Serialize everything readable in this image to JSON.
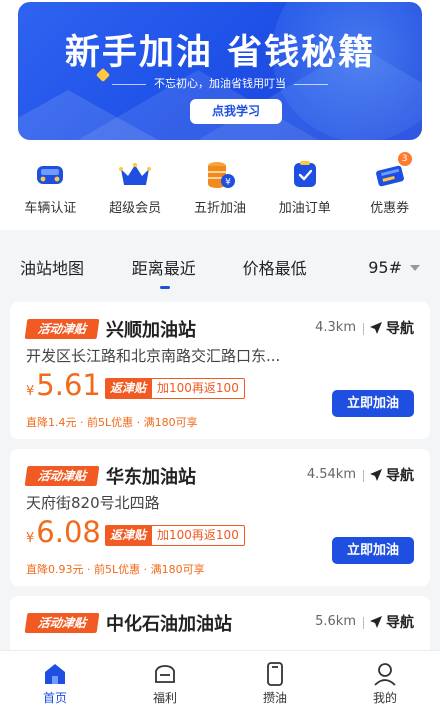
{
  "banner": {
    "title": "新手加油 省钱秘籍",
    "subtitle": "不忘初心，加油省钱用叮当",
    "button": "点我学习"
  },
  "quick_nav": [
    {
      "label": "车辆认证",
      "icon": "car-icon"
    },
    {
      "label": "超级会员",
      "icon": "crown-icon"
    },
    {
      "label": "五折加油",
      "icon": "coin-stack-icon"
    },
    {
      "label": "加油订单",
      "icon": "order-icon"
    },
    {
      "label": "优惠券",
      "icon": "coupon-icon",
      "badge": "3"
    }
  ],
  "filter": {
    "map": "油站地图",
    "nearest": "距离最近",
    "cheapest": "价格最低",
    "fuel": "95#"
  },
  "stations": [
    {
      "tag": "活动津贴",
      "name": "兴顺加油站",
      "distance": "4.3km",
      "nav": "导航",
      "address": "开发区长江路和北京南路交汇路口东...",
      "currency": "¥",
      "price": "5.61",
      "fanjin_label": "返津贴",
      "fanjin_text": "加100再返100",
      "promo": "直降1.4元 · 前5L优惠 · 满180可享",
      "button": "立即加油"
    },
    {
      "tag": "活动津贴",
      "name": "华东加油站",
      "distance": "4.54km",
      "nav": "导航",
      "address": "天府街820号北四路",
      "currency": "¥",
      "price": "6.08",
      "fanjin_label": "返津贴",
      "fanjin_text": "加100再返100",
      "promo": "直降0.93元 · 前5L优惠 · 满180可享",
      "button": "立即加油"
    },
    {
      "tag": "活动津贴",
      "name": "中化石油加油站",
      "distance": "5.6km",
      "nav": "导航"
    }
  ],
  "tabbar": [
    {
      "label": "首页",
      "icon": "home-icon",
      "active": true
    },
    {
      "label": "福利",
      "icon": "gift-car-icon"
    },
    {
      "label": "攒油",
      "icon": "phone-icon"
    },
    {
      "label": "我的",
      "icon": "user-icon"
    }
  ],
  "colors": {
    "brand_blue": "#1e4fe0",
    "accent_orange": "#f15a22"
  }
}
